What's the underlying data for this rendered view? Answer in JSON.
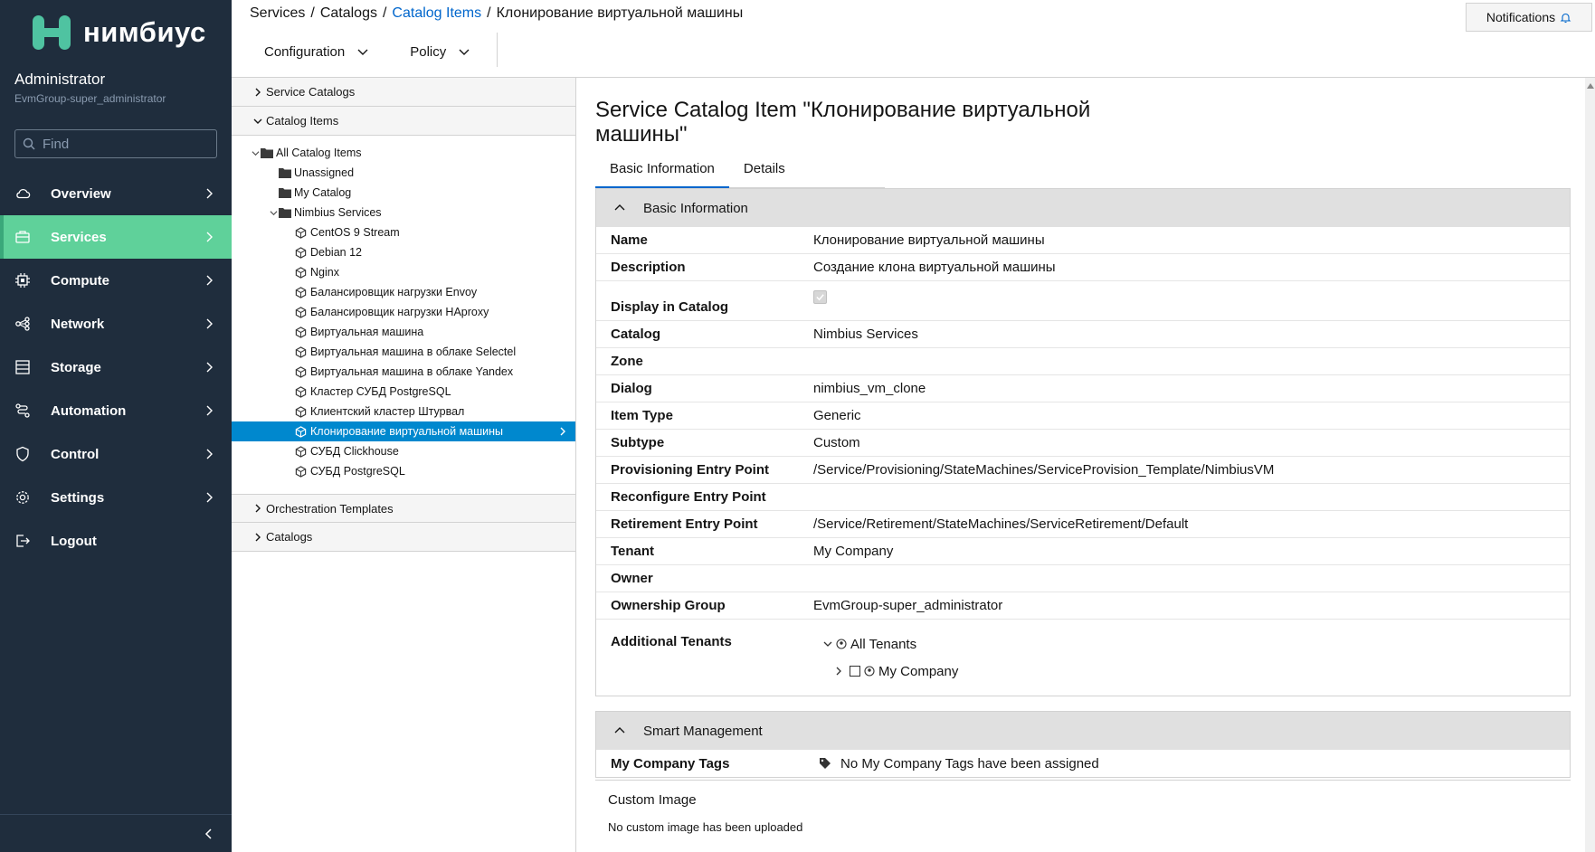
{
  "brand": {
    "logo_text": "нимбиус",
    "logo_color": "#4fc3a1"
  },
  "user": {
    "name": "Administrator",
    "group": "EvmGroup-super_administrator"
  },
  "search": {
    "placeholder": "Find"
  },
  "nav": [
    {
      "label": "Overview",
      "icon": "cloud-icon"
    },
    {
      "label": "Services",
      "icon": "services-icon",
      "active": true
    },
    {
      "label": "Compute",
      "icon": "cpu-icon"
    },
    {
      "label": "Network",
      "icon": "network-icon"
    },
    {
      "label": "Storage",
      "icon": "storage-icon"
    },
    {
      "label": "Automation",
      "icon": "automation-icon"
    },
    {
      "label": "Control",
      "icon": "shield-icon"
    },
    {
      "label": "Settings",
      "icon": "gear-icon"
    },
    {
      "label": "Logout",
      "icon": "logout-icon"
    }
  ],
  "breadcrumb": {
    "b1": "Services",
    "b2": "Catalogs",
    "b3": "Catalog Items",
    "b4": "Клонирование виртуальной машины",
    "sep": "/"
  },
  "toolbar": {
    "configuration": "Configuration",
    "policy": "Policy"
  },
  "notifications": {
    "label": "Notifications"
  },
  "accordion": {
    "service_catalogs": "Service Catalogs",
    "catalog_items": "Catalog Items",
    "orchestration_templates": "Orchestration Templates",
    "catalogs": "Catalogs"
  },
  "tree": {
    "root": "All Catalog Items",
    "unassigned": "Unassigned",
    "my_catalog": "My Catalog",
    "nimbius": "Nimbius Services",
    "items": [
      "CentOS 9 Stream",
      "Debian 12",
      "Nginx",
      "Балансировщик нагрузки Envoy",
      "Балансировщик нагрузки HAproxy",
      "Виртуальная машина",
      "Виртуальная машина в облаке Selectel",
      "Виртуальная машина в облаке Yandex",
      "Кластер СУБД PostgreSQL",
      "Клиентский кластер Штурвал",
      "Клонирование виртуальной машины",
      "СУБД Clickhouse",
      "СУБД PostgreSQL"
    ],
    "selected_index": 10
  },
  "page": {
    "title": "Service Catalog Item \"Клонирование виртуальной машины\"",
    "tabs": [
      "Basic Information",
      "Details"
    ]
  },
  "basic": {
    "heading": "Basic Information",
    "rows": [
      {
        "label": "Name",
        "value": "Клонирование виртуальной машины"
      },
      {
        "label": "Description",
        "value": "Создание клона виртуальной машины"
      },
      {
        "label": "Display in Catalog",
        "value": ""
      },
      {
        "label": "Catalog",
        "value": "Nimbius Services"
      },
      {
        "label": "Zone",
        "value": ""
      },
      {
        "label": "Dialog",
        "value": "nimbius_vm_clone"
      },
      {
        "label": "Item Type",
        "value": "Generic"
      },
      {
        "label": "Subtype",
        "value": "Custom"
      },
      {
        "label": "Provisioning Entry Point",
        "value": "/Service/Provisioning/StateMachines/ServiceProvision_Template/NimbiusVM"
      },
      {
        "label": "Reconfigure Entry Point",
        "value": ""
      },
      {
        "label": "Retirement Entry Point",
        "value": "/Service/Retirement/StateMachines/ServiceRetirement/Default"
      },
      {
        "label": "Tenant",
        "value": "My Company"
      },
      {
        "label": "Owner",
        "value": ""
      },
      {
        "label": "Ownership Group",
        "value": "EvmGroup-super_administrator"
      },
      {
        "label": "Additional Tenants",
        "value": ""
      }
    ],
    "display_in_catalog_checked": true,
    "tenants": {
      "all": "All Tenants",
      "child": "My Company"
    }
  },
  "smart": {
    "heading": "Smart Management",
    "tags_label": "My Company Tags",
    "tags_value": "No My Company Tags have been assigned"
  },
  "custom_image": {
    "title": "Custom Image",
    "message": "No custom image has been uploaded"
  }
}
